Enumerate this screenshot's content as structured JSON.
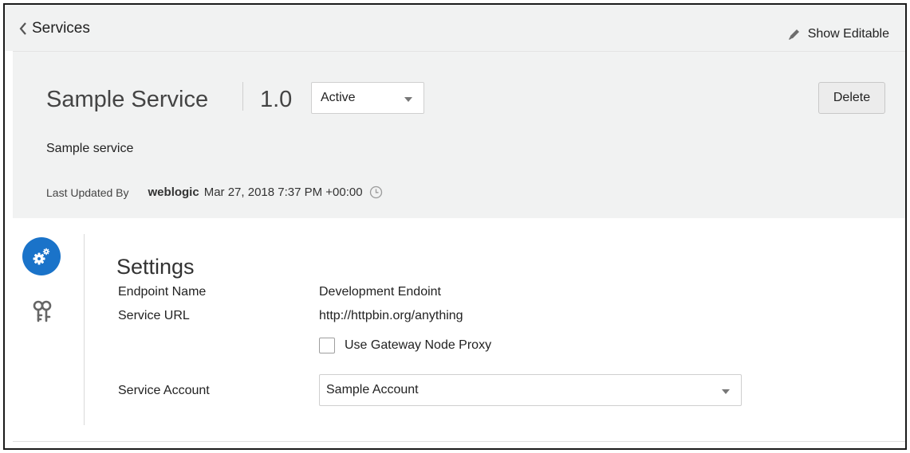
{
  "nav": {
    "back_label": "Services",
    "show_editable_label": "Show Editable"
  },
  "header": {
    "title": "Sample Service",
    "version": "1.0",
    "status": {
      "selected": "Active"
    },
    "delete_label": "Delete",
    "description": "Sample service",
    "last_updated_label": "Last Updated By",
    "last_updated_user": "weblogic",
    "last_updated_time": "Mar 27, 2018 7:37 PM +00:00"
  },
  "rail": {
    "items": [
      {
        "icon": "settings-gears-icon",
        "active": true
      },
      {
        "icon": "keys-icon",
        "active": false
      }
    ]
  },
  "settings": {
    "title": "Settings",
    "endpoint_name_label": "Endpoint Name",
    "endpoint_name_value": "Development Endoint",
    "service_url_label": "Service URL",
    "service_url_value": "http://httpbin.org/anything",
    "gateway_proxy_label": "Use Gateway Node Proxy",
    "gateway_proxy_checked": false,
    "service_account_label": "Service Account",
    "service_account_value": "Sample Account"
  },
  "colors": {
    "accent": "#1a73c9",
    "header_bg": "#f1f2f2"
  }
}
